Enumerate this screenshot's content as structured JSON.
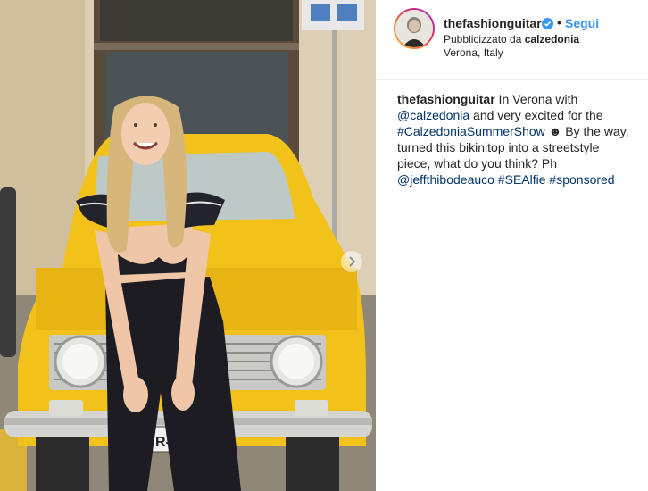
{
  "post": {
    "username": "thefashionguitar",
    "follow_label": "Segui",
    "separator": "•",
    "sponsored_prefix": "Pubblicizzato da",
    "sponsor": "calzedonia",
    "location": "Verona, Italy"
  },
  "caption": {
    "user": "thefashionguitar",
    "part1": " In Verona with ",
    "mention1": "@calzedonia",
    "part2": " and very excited for the ",
    "hashtag1": "#CalzedoniaSummerShow",
    "emoji": "☻",
    "part3": " By the way, turned this bikinitop into a streetstyle piece, what do you think? Ph ",
    "mention2": "@jeffthibodeauco",
    "part4": " ",
    "hashtag2": "#SEAlfie",
    "part5": " ",
    "hashtag3": "#sponsored"
  },
  "icons": {
    "verified": "verified-badge-icon",
    "next": "chevron-right-icon"
  },
  "colors": {
    "link_blue": "#3897f0",
    "text": "#262626",
    "car_yellow": "#f2c21b"
  }
}
